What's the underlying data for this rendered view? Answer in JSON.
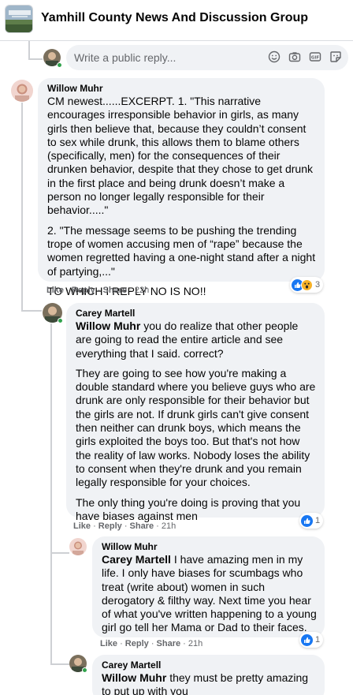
{
  "header": {
    "title": "Yamhill County News And Discussion Group"
  },
  "composer": {
    "placeholder": "Write a public reply..."
  },
  "comments": [
    {
      "author": "Willow Muhr",
      "paragraphs": [
        "CM newest......EXCERPT. 1. \"This narrative encourages irresponsible behavior in girls, as many girls then believe that, because they couldn’t consent to sex while drunk, this allows them to blame others (specifically, men) for the consequences of their drunken behavior, despite that they chose to get drunk in the first place and being drunk doesn’t make a person no longer legally responsible for their behavior.....\"",
        "2. \"The message seems to be pushing the trending trope of women accusing men of “rape” because the women regretted having a one-night stand after a night of partying,...\"",
        "TO WHICH I REPLY NO IS NO!!"
      ],
      "like": "Like",
      "reply": "Reply",
      "share": "Share",
      "time": "22h",
      "reaction_count": "3"
    },
    {
      "author": "Carey Martell",
      "mention": "Willow Muhr",
      "first_paragraph_rest": " you do realize that other people are going to read the entire article and see everything that I said. correct?",
      "paragraphs": [
        "They are going to see how you're making a double standard where you believe guys who are drunk are only responsible for their behavior but the girls are not. If drunk girls can't give consent then neither can drunk boys, which means the girls exploited the boys too. But that's not how the reality of law works. Nobody loses the ability to consent when they're drunk and you remain legally responsible for your choices.",
        "The only thing you're doing is proving that you have biases against men"
      ],
      "like": "Like",
      "reply": "Reply",
      "share": "Share",
      "time": "21h",
      "reaction_count": "1"
    },
    {
      "author": "Willow Muhr",
      "mention": "Carey Martell",
      "first_paragraph_rest": " I have amazing men in my life. I only have biases for scumbags who treat (write about) women in such derogatory & filthy way. Next time you hear of what you've written happening to a young girl go tell her Mama or Dad to their faces.",
      "like": "Like",
      "reply": "Reply",
      "share": "Share",
      "time": "21h",
      "reaction_count": "1"
    },
    {
      "author": "Carey Martell",
      "mention": "Willow Muhr",
      "first_paragraph_rest": " they must be pretty amazing to put up with you"
    }
  ],
  "colors": {
    "like_blue": "#1877f2",
    "bubble_bg": "#f0f2f5",
    "meta_gray": "#65676b",
    "online_green": "#31a24c"
  },
  "icons": [
    "emoji-icon",
    "camera-icon",
    "gif-icon",
    "sticker-icon",
    "like-reaction-icon",
    "wow-reaction-icon"
  ]
}
